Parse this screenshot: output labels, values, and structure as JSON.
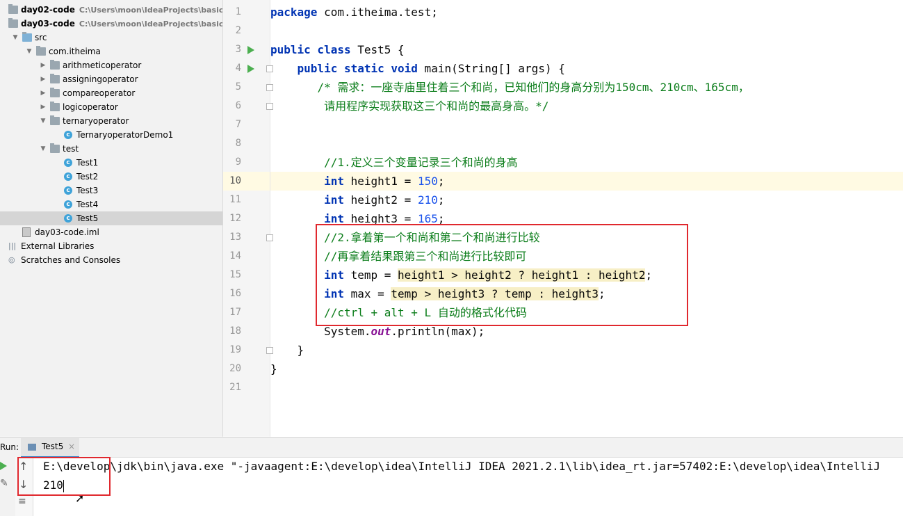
{
  "tree": {
    "items": [
      {
        "label": "day02-code",
        "path": "C:\\Users\\moon\\IdeaProjects\\basic-co",
        "type": "module",
        "bold": true
      },
      {
        "label": "day03-code",
        "path": "C:\\Users\\moon\\IdeaProjects\\basic-co",
        "type": "module",
        "bold": true
      },
      {
        "label": "src",
        "type": "src"
      },
      {
        "label": "com.itheima",
        "type": "package"
      },
      {
        "label": "arithmeticoperator",
        "type": "package"
      },
      {
        "label": "assigningoperator",
        "type": "package"
      },
      {
        "label": "compareoperator",
        "type": "package"
      },
      {
        "label": "logicoperator",
        "type": "package"
      },
      {
        "label": "ternaryoperator",
        "type": "package"
      },
      {
        "label": "TernaryoperatorDemo1",
        "type": "class"
      },
      {
        "label": "test",
        "type": "package"
      },
      {
        "label": "Test1",
        "type": "class"
      },
      {
        "label": "Test2",
        "type": "class"
      },
      {
        "label": "Test3",
        "type": "class"
      },
      {
        "label": "Test4",
        "type": "class"
      },
      {
        "label": "Test5",
        "type": "class",
        "selected": true
      },
      {
        "label": "day03-code.iml",
        "type": "file"
      },
      {
        "label": "External Libraries",
        "type": "lib"
      },
      {
        "label": "Scratches and Consoles",
        "type": "scratch"
      }
    ]
  },
  "editor": {
    "line_numbers": [
      "1",
      "2",
      "3",
      "4",
      "5",
      "6",
      "7",
      "8",
      "9",
      "10",
      "11",
      "12",
      "13",
      "14",
      "15",
      "16",
      "17",
      "18",
      "19",
      "20",
      "21"
    ],
    "current_line": "10",
    "tokens": {
      "l1_kw": "package",
      "l1_rest": " com.itheima.test;",
      "l3_kw": "public class",
      "l3_rest": " Test5 {",
      "l4_kw": "public static void",
      "l4_rest": " main(String[] args) {",
      "l5": "/* 需求：一座寺庙里住着三个和尚，已知他们的身高分别为150cm、210cm、165cm，",
      "l6": "请用程序实现获取这三个和尚的最高身高。*/",
      "l9": "//1.定义三个变量记录三个和尚的身高",
      "int": "int",
      "l10_a": " height1 = ",
      "l10_n": "150",
      "semi": ";",
      "l11_a": " height2 = ",
      "l11_n": "210",
      "l12_a": " height3 = ",
      "l12_n": "165",
      "l13": "//2.拿着第一个和尚和第二个和尚进行比较",
      "l14": "//再拿着结果跟第三个和尚进行比较即可",
      "l15_a": " temp = ",
      "l15_expr": "height1 > height2 ? height1 : height2",
      "l16_a": " max = ",
      "l16_expr": "temp > height3 ? temp : height3",
      "l17": "//ctrl + alt + L 自动的格式化代码",
      "l18_a": "System.",
      "l18_out": "out",
      "l18_b": ".println(max);",
      "l19": "}",
      "l20": "}"
    }
  },
  "run": {
    "label": "Run:",
    "tab": "Test5",
    "tab_close": "×",
    "command": "E:\\develop\\jdk\\bin\\java.exe \"-javaagent:E:\\develop\\idea\\IntelliJ IDEA 2021.2.1\\lib\\idea_rt.jar=57402:E:\\develop\\idea\\IntelliJ",
    "output": "210"
  },
  "colors": {
    "keyword": "#0033b3",
    "number": "#1750eb",
    "comment": "#8c8c8c",
    "doc_comment": "#0b7d1a",
    "highlight_box": "#e0282e"
  }
}
